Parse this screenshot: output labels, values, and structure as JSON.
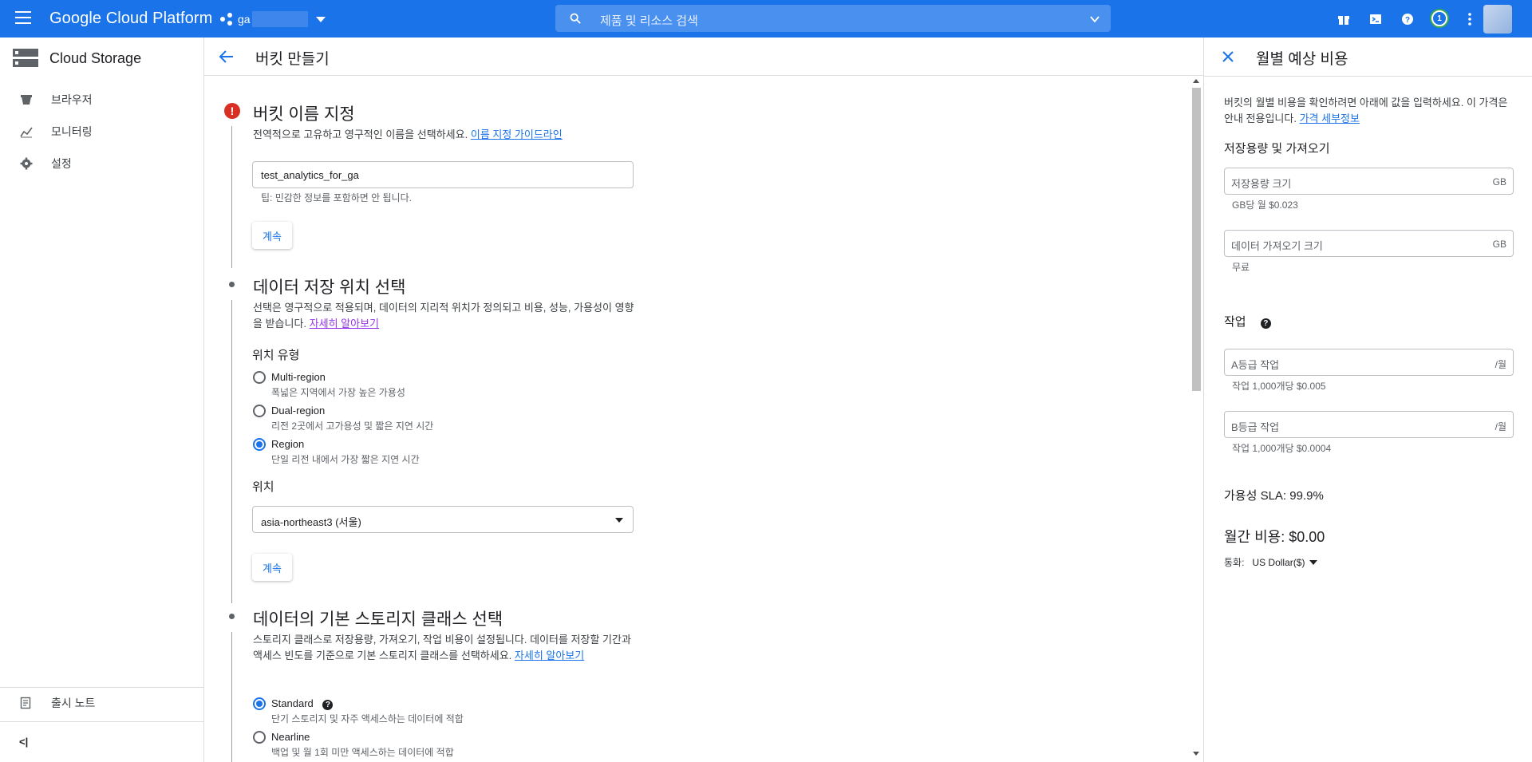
{
  "topbar": {
    "brand": "Google Cloud Platform",
    "project_name": "ga",
    "search_placeholder": "제품 및 리소스 검색",
    "notification_count": "1"
  },
  "leftnav": {
    "product": "Cloud Storage",
    "items": [
      {
        "label": "브라우저",
        "icon": "bucket-icon"
      },
      {
        "label": "모니터링",
        "icon": "chart-icon"
      },
      {
        "label": "설정",
        "icon": "gear-icon"
      }
    ],
    "release_notes": "출시 노트",
    "collapse_label": "<|"
  },
  "header": {
    "title": "버킷 만들기"
  },
  "step1": {
    "title": "버킷 이름 지정",
    "desc": "전역적으로 고유하고 영구적인 이름을 선택하세요.",
    "link": "이름 지정 가이드라인",
    "input_value": "test_analytics_for_ga",
    "hint": "팁: 민감한 정보를 포함하면 안 됩니다.",
    "continue": "계속"
  },
  "step2": {
    "title": "데이터 저장 위치 선택",
    "desc": "선택은 영구적으로 적용되며, 데이터의 지리적 위치가 정의되고 비용, 성능, 가용성이 영향을 받습니다.",
    "link": "자세히 알아보기",
    "location_type_label": "위치 유형",
    "options": [
      {
        "label": "Multi-region",
        "sub": "폭넓은 지역에서 가장 높은 가용성",
        "selected": false
      },
      {
        "label": "Dual-region",
        "sub": "리전 2곳에서 고가용성 및 짧은 지연 시간",
        "selected": false
      },
      {
        "label": "Region",
        "sub": "단일 리전 내에서 가장 짧은 지연 시간",
        "selected": true
      }
    ],
    "location_label": "위치",
    "location_value": "asia-northeast3 (서울)",
    "continue": "계속"
  },
  "step3": {
    "title": "데이터의 기본 스토리지 클래스 선택",
    "desc": "스토리지 클래스로 저장용량, 가져오기, 작업 비용이 설정됩니다. 데이터를 저장할 기간과 액세스 빈도를 기준으로 기본 스토리지 클래스를 선택하세요.",
    "link": "자세히 알아보기",
    "options": [
      {
        "label": "Standard",
        "sub": "단기 스토리지 및 자주 액세스하는 데이터에 적합",
        "selected": true
      },
      {
        "label": "Nearline",
        "sub": "백업 및 월 1회 미만 액세스하는 데이터에 적합",
        "selected": false
      }
    ]
  },
  "cost_panel": {
    "title": "월별 예상 비용",
    "desc": "버킷의 월별 비용을 확인하려면 아래에 값을 입력하세요. 이 가격은 안내 전용입니다.",
    "link": "가격 세부정보",
    "storage_section": "저장용량 및 가져오기",
    "storage_size_placeholder": "저장용량 크기",
    "storage_size_unit": "GB",
    "storage_size_hint": "GB당 월 $0.023",
    "retrieval_placeholder": "데이터 가져오기 크기",
    "retrieval_unit": "GB",
    "retrieval_hint": "무료",
    "ops_section": "작업",
    "class_a_placeholder": "A등급 작업",
    "class_a_unit": "/월",
    "class_a_hint": "작업 1,000개당 $0.005",
    "class_b_placeholder": "B등급 작업",
    "class_b_unit": "/월",
    "class_b_hint": "작업 1,000개당 $0.0004",
    "sla": "가용성 SLA: 99.9%",
    "monthly_cost": "월간 비용: $0.00",
    "currency_label": "통화:",
    "currency_value": "US Dollar($)"
  },
  "colors": {
    "topbar": "#1a73e8",
    "link": "#1a73e8",
    "visited_link": "#9334e6",
    "error": "#d93025"
  }
}
